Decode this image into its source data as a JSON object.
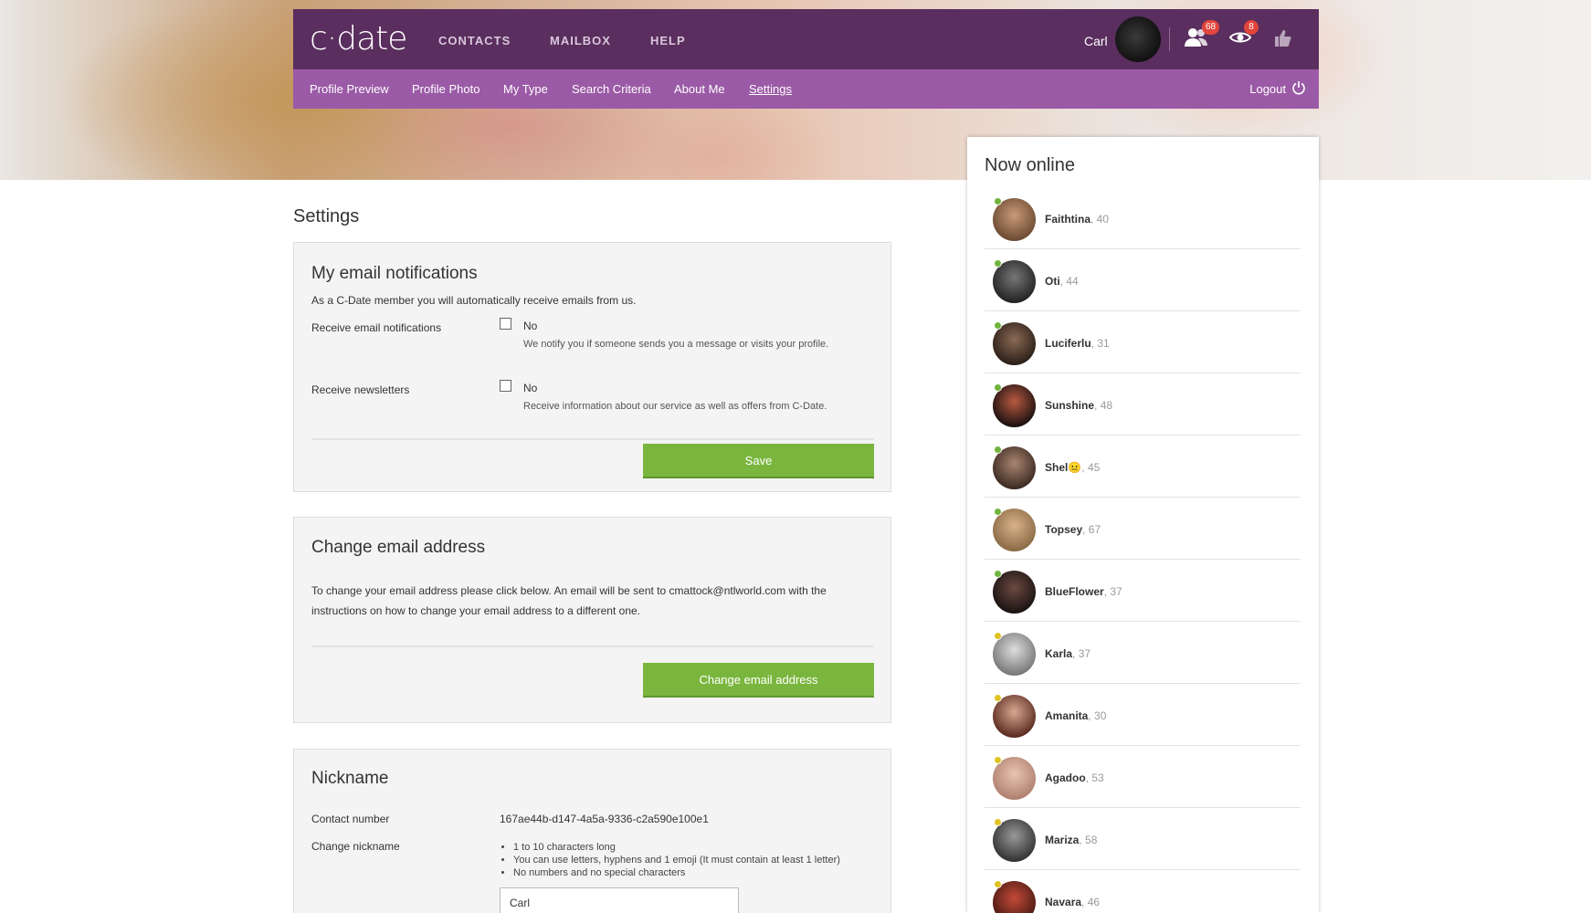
{
  "header": {
    "logo": "c·date",
    "nav": [
      "CONTACTS",
      "MAILBOX",
      "HELP"
    ],
    "user_name": "Carl",
    "contacts_badge": "68",
    "visitors_badge": "8",
    "subnav": [
      "Profile Preview",
      "Profile Photo",
      "My Type",
      "Search Criteria",
      "About Me",
      "Settings"
    ],
    "active_subnav": "Settings",
    "logout": "Logout"
  },
  "page_title": "Settings",
  "email_notifications": {
    "title": "My email notifications",
    "intro": "As a C-Date member you will automatically receive emails from us.",
    "rows": [
      {
        "label": "Receive email notifications",
        "value": "No",
        "hint": "We notify you if someone sends you a message or visits your profile."
      },
      {
        "label": "Receive newsletters",
        "value": "No",
        "hint": "Receive information about our service as well as offers from C-Date."
      }
    ],
    "save_label": "Save"
  },
  "change_email": {
    "title": "Change email address",
    "text_line1": "To change your email address please click below. An email will be sent to cmattock@ntlworld.com with the",
    "text_line2": "instructions on how to change your email address to a different one.",
    "button_label": "Change email address"
  },
  "nickname": {
    "title": "Nickname",
    "contact_label": "Contact number",
    "contact_value": "167ae44b-d147-4a5a-9336-c2a590e100e1",
    "change_label": "Change nickname",
    "rules": [
      "1 to 10 characters long",
      "You can use letters, hyphens and 1 emoji (It must contain at least 1 letter)",
      "No numbers and no special characters"
    ],
    "input_value": "Carl"
  },
  "now_online": {
    "title": "Now online",
    "people": [
      {
        "name": "Faithtina",
        "age": "40",
        "status": "green"
      },
      {
        "name": "Oti",
        "age": "44",
        "status": "green"
      },
      {
        "name": "Luciferlu",
        "age": "31",
        "status": "green"
      },
      {
        "name": "Sunshine",
        "age": "48",
        "status": "green"
      },
      {
        "name": "Shel😐",
        "age": "45",
        "status": "green"
      },
      {
        "name": "Topsey",
        "age": "67",
        "status": "green"
      },
      {
        "name": "BlueFlower",
        "age": "37",
        "status": "green"
      },
      {
        "name": "Karla",
        "age": "37",
        "status": "yellow"
      },
      {
        "name": "Amanita",
        "age": "30",
        "status": "yellow"
      },
      {
        "name": "Agadoo",
        "age": "53",
        "status": "yellow"
      },
      {
        "name": "Mariza",
        "age": "58",
        "status": "yellow"
      },
      {
        "name": "Navara",
        "age": "46",
        "status": "yellow"
      }
    ]
  },
  "colors": {
    "topbar": "#5a2e5e",
    "subbar": "#9b5aa6",
    "button_green": "#7ab63e",
    "online_green": "#6fb43b",
    "online_yellow": "#e0c323",
    "badge_red": "#e2453c"
  }
}
